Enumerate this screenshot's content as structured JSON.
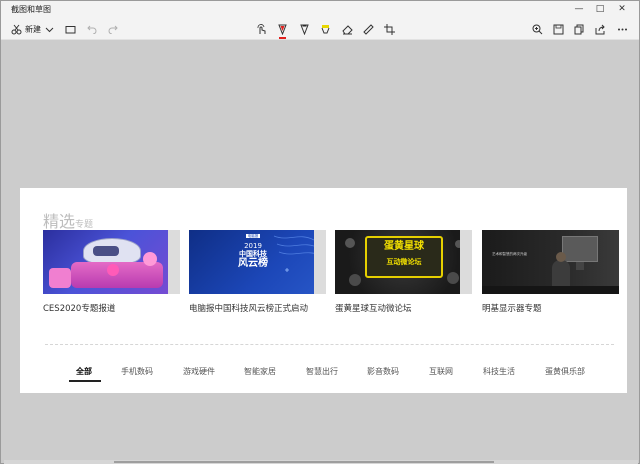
{
  "app": {
    "title": "截图和草图"
  },
  "toolbar": {
    "new_label": "新建",
    "pen_colors": [
      "#222222",
      "#e0201e",
      "#e8d800"
    ]
  },
  "section": {
    "title_big": "精选",
    "title_small": "专题"
  },
  "tiles": [
    {
      "caption": "CES2020专题报道"
    },
    {
      "caption": "电脑报中国科技风云榜正式启动",
      "thumb_badge": "电脑报",
      "thumb_year": "2019",
      "thumb_title_1": "中国科技",
      "thumb_title_2": "风云榜"
    },
    {
      "caption": "蛋黄星球互动微论坛",
      "thumb_sign_1": "蛋黄星球",
      "thumb_sign_2": "互动微论坛"
    },
    {
      "caption": "明基显示器专题",
      "thumb_text": "艺术和智慧的两次升级"
    }
  ],
  "tabs": [
    "全部",
    "手机数码",
    "游戏硬件",
    "智能家居",
    "智慧出行",
    "影音数码",
    "互联网",
    "科技生活",
    "蛋黄俱乐部"
  ]
}
